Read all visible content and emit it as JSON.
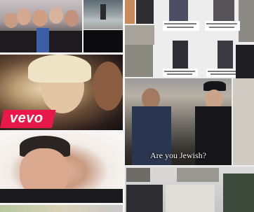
{
  "left_column": {
    "music_video_overlay": "vevo"
  },
  "street_video": {
    "caption": "Are you Jewish?"
  },
  "colors": {
    "vevo_red": "#e8184b",
    "page_bg": "#f4f4f4"
  }
}
